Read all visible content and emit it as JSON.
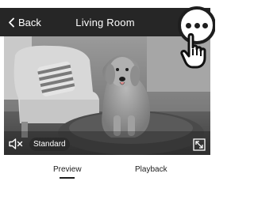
{
  "header": {
    "back_label": "Back",
    "title": "Living Room"
  },
  "video": {
    "quality_label": "Standard"
  },
  "tabs": [
    {
      "label": "Preview",
      "active": true
    },
    {
      "label": "Playback",
      "active": false
    }
  ],
  "icons": {
    "back": "chevron-left-icon",
    "more": "ellipsis-icon",
    "hand": "hand-pointer-icon",
    "mute": "speaker-muted-icon",
    "fullscreen": "fullscreen-icon"
  },
  "colors": {
    "header_bg": "#262626",
    "text_dark": "#1e1e1e"
  }
}
